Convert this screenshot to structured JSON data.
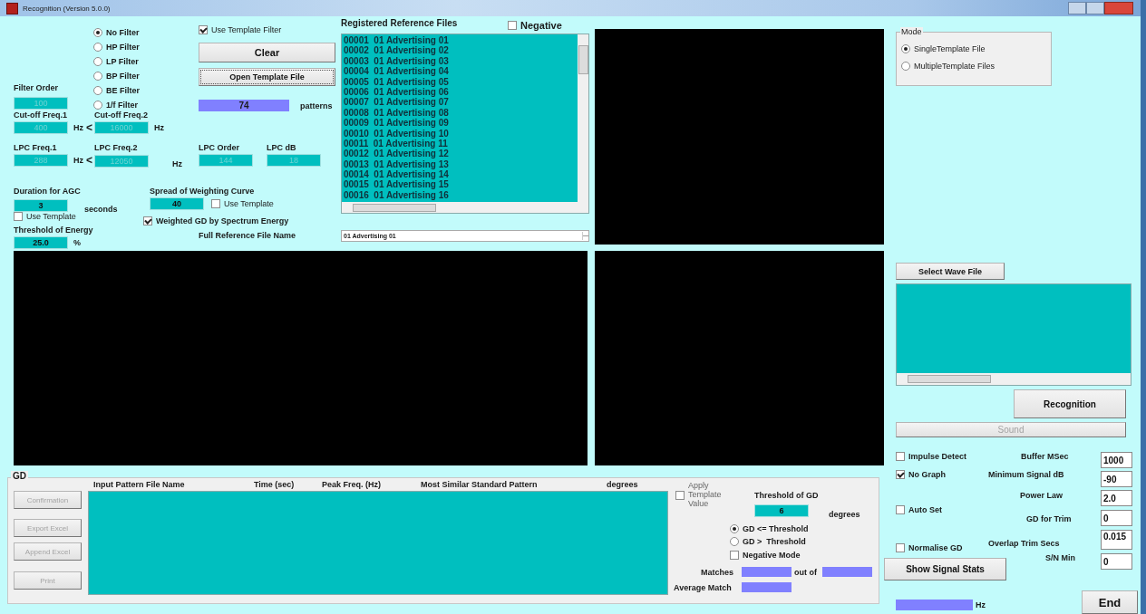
{
  "window": {
    "title": "Recognition (Version 5.0.0)"
  },
  "filter_types": [
    {
      "label": "No Filter",
      "selected": true
    },
    {
      "label": "HP Filter",
      "selected": false
    },
    {
      "label": "LP Filter",
      "selected": false
    },
    {
      "label": "BP Filter",
      "selected": false
    },
    {
      "label": "BE Filter",
      "selected": false
    },
    {
      "label": "1/f Filter",
      "selected": false
    }
  ],
  "use_template_filter": {
    "label": "Use Template Filter",
    "checked": true
  },
  "clear_button": "Clear",
  "open_template_button": "Open Template File",
  "patterns": {
    "value": "74",
    "unit": "patterns"
  },
  "parameters": [
    {
      "label": "Filter Order",
      "value": "100",
      "disabled": true
    },
    {
      "label": "Cut-off Freq.1",
      "value": "400",
      "disabled": true,
      "unit": "Hz",
      "comparator": "<"
    },
    {
      "label": "Cut-off Freq.2",
      "value": "16000",
      "disabled": true,
      "unit": "Hz"
    },
    {
      "label": "LPC Freq.1",
      "value": "288",
      "disabled": true,
      "unit": "Hz",
      "comparator": "<"
    },
    {
      "label": "LPC Freq.2",
      "value": "12050",
      "disabled": true,
      "unit": "Hz"
    },
    {
      "label": "LPC Order",
      "value": "144",
      "disabled": true
    },
    {
      "label": "LPC dB",
      "value": "18",
      "disabled": true
    },
    {
      "label": "Duration for AGC",
      "value": "3",
      "disabled": false,
      "unit": "seconds"
    },
    {
      "label": "Spread of Weighting Curve",
      "value": "40",
      "disabled": false
    },
    {
      "label": "Threshold of Energy",
      "value": "25.0",
      "disabled": false,
      "unit": "%"
    }
  ],
  "agc_use_template": {
    "label": "Use Template",
    "checked": false
  },
  "spread_use_template": {
    "label": "Use Template",
    "checked": false
  },
  "weighted_gd": {
    "label": "Weighted GD by Spectrum Energy",
    "checked": true
  },
  "full_reference_label": "Full Reference File Name",
  "reference_files": {
    "title": "Registered Reference Files",
    "negative": {
      "label": "Negative",
      "checked": false
    },
    "items": [
      "00001  01 Advertising 01",
      "00002  01 Advertising 02",
      "00003  01 Advertising 03",
      "00004  01 Advertising 04",
      "00005  01 Advertising 05",
      "00006  01 Advertising 06",
      "00007  01 Advertising 07",
      "00008  01 Advertising 08",
      "00009  01 Advertising 09",
      "00010  01 Advertising 10",
      "00011  01 Advertising 11",
      "00012  01 Advertising 12",
      "00013  01 Advertising 13",
      "00014  01 Advertising 14",
      "00015  01 Advertising 15",
      "00016  01 Advertising 16"
    ],
    "full_name": "01 Advertising 01"
  },
  "mode": {
    "title": "Mode",
    "options": [
      {
        "label": "SingleTemplate File",
        "selected": true
      },
      {
        "label": "MultipleTemplate Files",
        "selected": false
      }
    ]
  },
  "select_wave_button": "Select Wave File",
  "recognition_button": "Recognition",
  "sound_button": {
    "label": "Sound",
    "disabled": true
  },
  "options": [
    {
      "label": "Impulse Detect",
      "checked": false
    },
    {
      "label": "No Graph",
      "checked": true
    },
    {
      "label": "Auto Set",
      "checked": false
    },
    {
      "label": "Normalise GD",
      "checked": false
    }
  ],
  "settings": [
    {
      "label": "Buffer MSec",
      "value": "1000"
    },
    {
      "label": "Minimum Signal dB",
      "value": "-90"
    },
    {
      "label": "Power Law",
      "value": "2.0"
    },
    {
      "label": "GD for Trim",
      "value": "0"
    },
    {
      "label": "Overlap Trim Secs",
      "value": "0.015"
    },
    {
      "label": "S/N Min",
      "value": "0"
    }
  ],
  "show_stats_button": "Show Signal Stats",
  "frequency_unit": "Hz",
  "end_button": "End",
  "gd": {
    "title": "GD",
    "columns": [
      "Input Pattern File Name",
      "Time (sec)",
      "Peak Freq. (Hz)",
      "Most Similar Standard Pattern",
      "degrees"
    ],
    "buttons": [
      {
        "label": "Confirmation",
        "disabled": true
      },
      {
        "label": "Export Excel",
        "disabled": true
      },
      {
        "label": "Append Excel",
        "disabled": true
      },
      {
        "label": "Print",
        "disabled": true
      }
    ],
    "apply_template": {
      "label": "Apply Template Value",
      "checked": false
    },
    "threshold": {
      "label": "Threshold of GD",
      "value": "6",
      "unit": "degrees"
    },
    "comparison": [
      {
        "label": "GD <= Threshold",
        "selected": true
      },
      {
        "label": "GD >  Threshold",
        "selected": false
      }
    ],
    "negative_mode": {
      "label": "Negative Mode",
      "checked": false
    },
    "matches_label": "Matches",
    "out_of_label": "out of",
    "average_match_label": "Average Match"
  }
}
